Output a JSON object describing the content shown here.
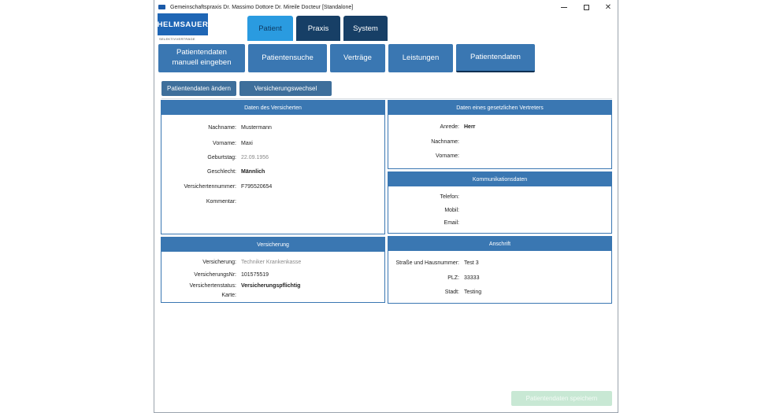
{
  "window": {
    "title": "Gemeinschaftspraxis Dr. Massimo Dottore Dr. Mireile Docteur  [Standalone]"
  },
  "logo": {
    "text": "HELMSAUER",
    "subtitle": "SELEKTIVVERTRÄGE"
  },
  "main_tabs": [
    {
      "label": "Patient"
    },
    {
      "label": "Praxis"
    },
    {
      "label": "System"
    }
  ],
  "sub_tabs": [
    {
      "label": "Patientendaten\nmanuell eingeben"
    },
    {
      "label": "Patientensuche"
    },
    {
      "label": "Verträge"
    },
    {
      "label": "Leistungen"
    },
    {
      "label": "Patientendaten"
    }
  ],
  "actions": {
    "edit": "Patientendaten ändern",
    "change_insurance": "Versicherungswechsel"
  },
  "insured": {
    "header": "Daten des Versicherten",
    "labels": [
      "Nachname:",
      "Vorname:",
      "Geburtstag:",
      "Geschlecht:",
      "Versichertennummer:",
      "Kommentar:"
    ],
    "values": [
      "Mustermann",
      "Maxi",
      "22.09.1956",
      "Männlich",
      "F795520654",
      ""
    ]
  },
  "representative": {
    "header": "Daten eines gesetzlichen Vertreters",
    "labels": [
      "Anrede:",
      "Nachname:",
      "Vorname:"
    ],
    "values": [
      "Herr",
      "",
      ""
    ]
  },
  "communication": {
    "header": "Kommunikationsdaten",
    "labels": [
      "Telefon:",
      "Mobil:",
      "Email:"
    ],
    "values": [
      "",
      "",
      ""
    ]
  },
  "insurance": {
    "header": "Versicherung",
    "labels": [
      "Versicherung:",
      "VersicherungsNr:",
      "Versichertenstatus:",
      "Karte:"
    ],
    "values": [
      "Techniker Krankenkasse",
      "101575519",
      "Versicherungspflichtig",
      ""
    ]
  },
  "address": {
    "header": "Anschrift",
    "labels": [
      "Straße und Hausnummer:",
      "PLZ:",
      "Stadt:"
    ],
    "values": [
      "Test 3",
      "33333",
      "Testing"
    ]
  },
  "footer": {
    "save_label": "Patientendaten speichern"
  }
}
